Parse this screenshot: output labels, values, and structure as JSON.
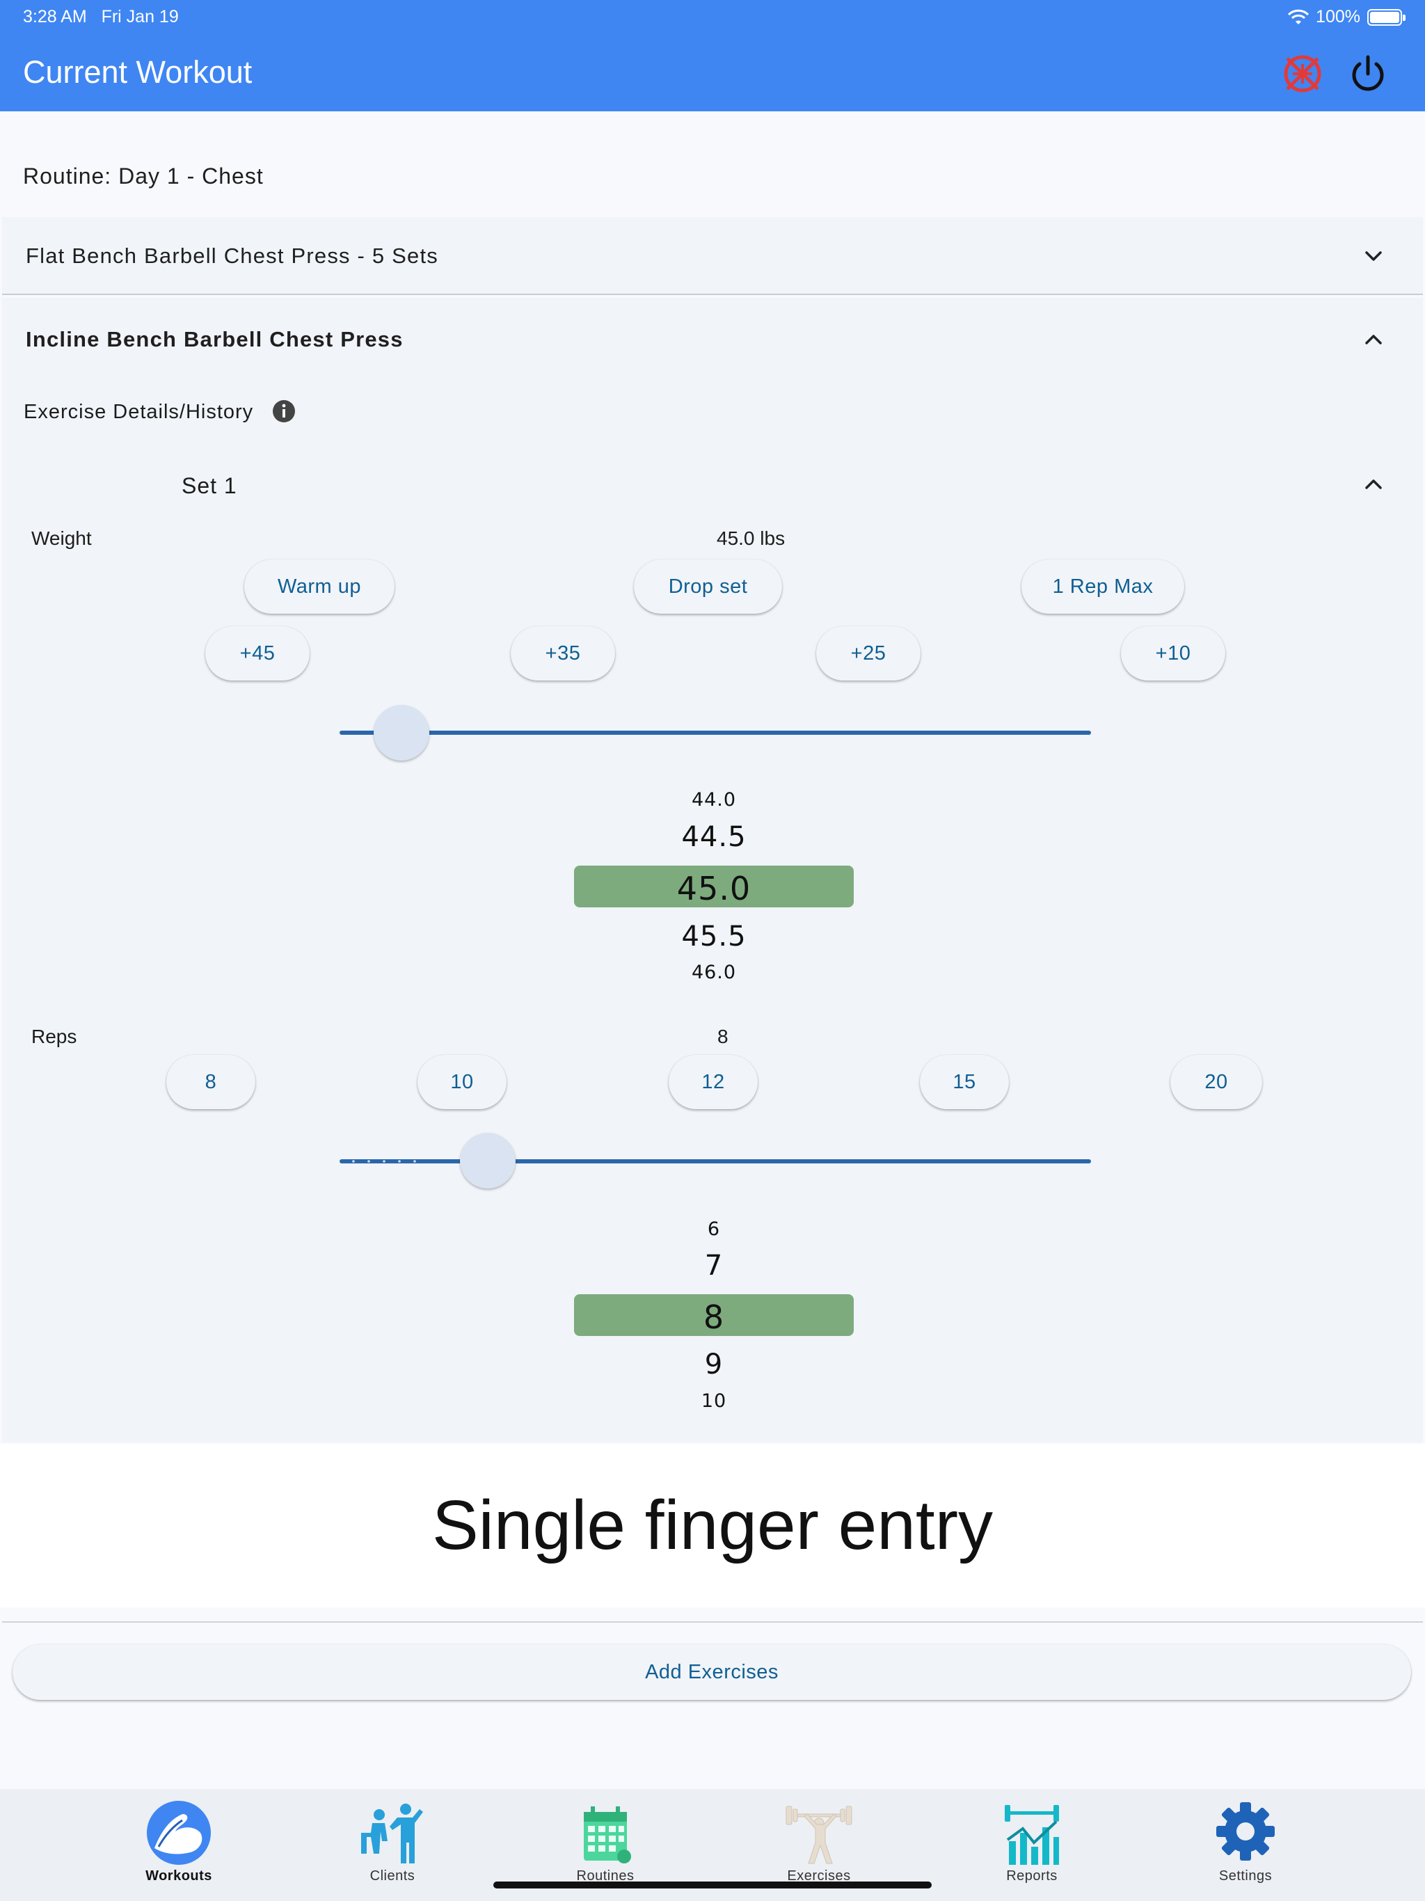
{
  "status_bar": {
    "time": "3:28 AM",
    "date": "Fri Jan 19",
    "battery": "100%"
  },
  "header": {
    "title": "Current Workout",
    "offline_icon": "offline-icon",
    "power_icon": "power-icon"
  },
  "routine": {
    "label": "Routine: Day 1 - Chest"
  },
  "exercises": [
    {
      "title": "Flat Bench Barbell Chest Press - 5 Sets",
      "expanded": false
    },
    {
      "title": "Incline Bench Barbell Chest Press",
      "expanded": true
    }
  ],
  "details": {
    "label": "Exercise Details/History",
    "icon": "info-icon"
  },
  "set": {
    "title": "Set 1",
    "weight": {
      "label": "Weight",
      "value": "45.0 lbs",
      "mode_buttons": [
        "Warm up",
        "Drop set",
        "1 Rep Max"
      ],
      "increment_buttons": [
        "+45",
        "+35",
        "+25",
        "+10"
      ],
      "slider_fraction": 0.045,
      "picker": [
        "44.0",
        "44.5",
        "45.0",
        "45.5",
        "46.0"
      ]
    },
    "reps": {
      "label": "Reps",
      "value": "8",
      "quick_buttons": [
        "8",
        "10",
        "12",
        "15",
        "20"
      ],
      "slider_fraction": 0.16,
      "picker": [
        "6",
        "7",
        "8",
        "9",
        "10"
      ]
    }
  },
  "caption": "Single finger entry",
  "add_button": "Add Exercises",
  "nav": [
    {
      "label": "Workouts",
      "icon": "biceps-icon",
      "active": true
    },
    {
      "label": "Clients",
      "icon": "clients-icon",
      "active": false
    },
    {
      "label": "Routines",
      "icon": "calendar-icon",
      "active": false
    },
    {
      "label": "Exercises",
      "icon": "weightlifter-icon",
      "active": false
    },
    {
      "label": "Reports",
      "icon": "reports-icon",
      "active": false
    },
    {
      "label": "Settings",
      "icon": "gear-icon",
      "active": false
    }
  ],
  "colors": {
    "header": "#3f86f3",
    "accent_text": "#0f5f93",
    "picker_selected": "#7dab7e",
    "slider": "#2b66ad"
  }
}
